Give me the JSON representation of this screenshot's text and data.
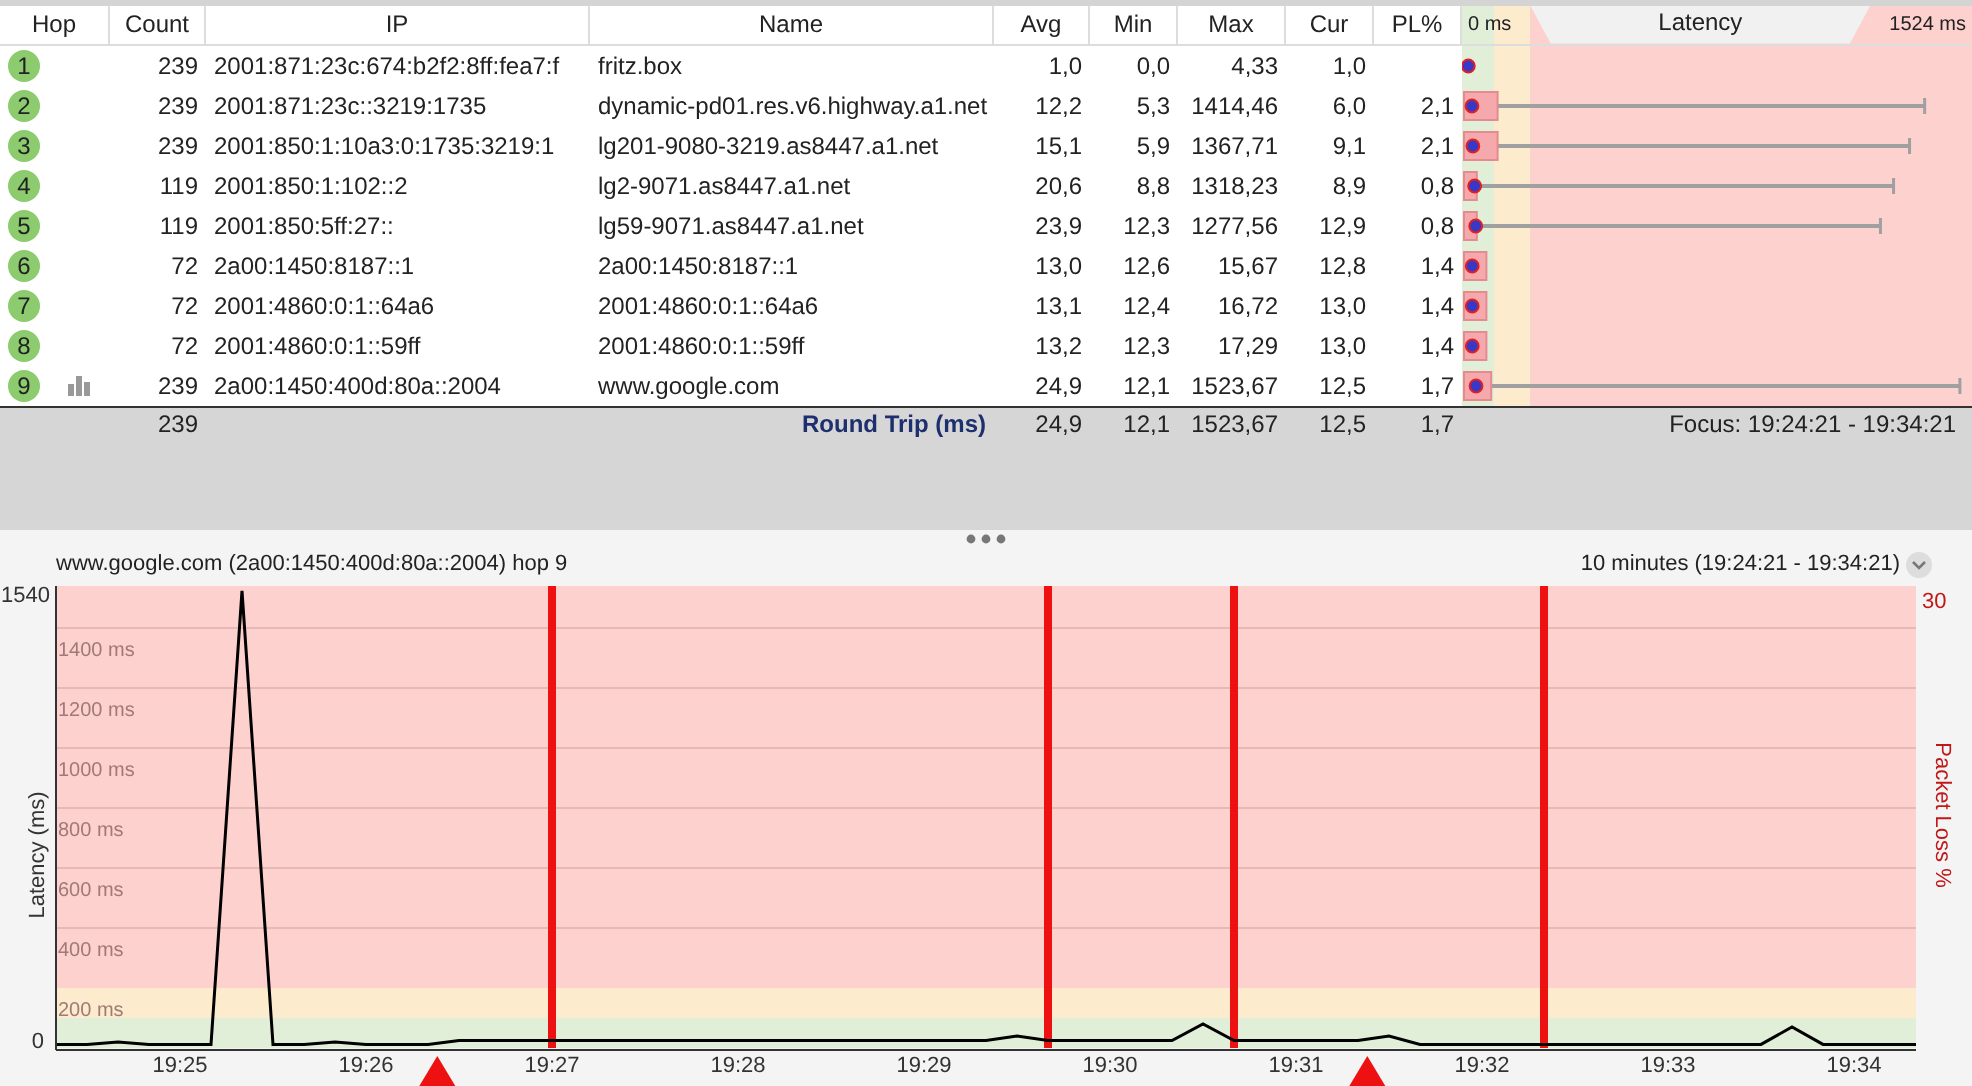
{
  "table": {
    "columns": [
      "Hop",
      "Count",
      "IP",
      "Name",
      "Avg",
      "Min",
      "Max",
      "Cur",
      "PL%",
      "Latency"
    ],
    "scale": {
      "min_label": "0 ms",
      "max_label": "1524 ms"
    },
    "rows": [
      {
        "hop": "1",
        "graphed": false,
        "count": "239",
        "ip": "2001:871:23c:674:b2f2:8ff:fea7:f",
        "name": "fritz.box",
        "avg": "1,0",
        "min": "0,0",
        "max": "4,33",
        "cur": "1,0"
      },
      {
        "hop": "2",
        "graphed": false,
        "count": "239",
        "ip": "2001:871:23c::3219:1735",
        "name": "dynamic-pd01.res.v6.highway.a1.net",
        "avg": "12,2",
        "min": "5,3",
        "max": "1414,46",
        "cur": "6,0",
        "pl": "2,1"
      },
      {
        "hop": "3",
        "graphed": false,
        "count": "239",
        "ip": "2001:850:1:10a3:0:1735:3219:1",
        "name": "lg201-9080-3219.as8447.a1.net",
        "avg": "15,1",
        "min": "5,9",
        "max": "1367,71",
        "cur": "9,1",
        "pl": "2,1"
      },
      {
        "hop": "4",
        "graphed": false,
        "count": "119",
        "ip": "2001:850:1:102::2",
        "name": "lg2-9071.as8447.a1.net",
        "avg": "20,6",
        "min": "8,8",
        "max": "1318,23",
        "cur": "8,9",
        "pl": "0,8"
      },
      {
        "hop": "5",
        "graphed": false,
        "count": "119",
        "ip": "2001:850:5ff:27::",
        "name": "lg59-9071.as8447.a1.net",
        "avg": "23,9",
        "min": "12,3",
        "max": "1277,56",
        "cur": "12,9",
        "pl": "0,8"
      },
      {
        "hop": "6",
        "graphed": false,
        "count": "72",
        "ip": "2a00:1450:8187::1",
        "name": "2a00:1450:8187::1",
        "avg": "13,0",
        "min": "12,6",
        "max": "15,67",
        "cur": "12,8",
        "pl": "1,4"
      },
      {
        "hop": "7",
        "graphed": false,
        "count": "72",
        "ip": "2001:4860:0:1::64a6",
        "name": "2001:4860:0:1::64a6",
        "avg": "13,1",
        "min": "12,4",
        "max": "16,72",
        "cur": "13,0",
        "pl": "1,4"
      },
      {
        "hop": "8",
        "graphed": false,
        "count": "72",
        "ip": "2001:4860:0:1::59ff",
        "name": "2001:4860:0:1::59ff",
        "avg": "13,2",
        "min": "12,3",
        "max": "17,29",
        "cur": "13,0",
        "pl": "1,4"
      },
      {
        "hop": "9",
        "graphed": true,
        "count": "239",
        "ip": "2a00:1450:400d:80a::2004",
        "name": "www.google.com",
        "avg": "24,9",
        "min": "12,1",
        "max": "1523,67",
        "cur": "12,5",
        "pl": "1,7"
      }
    ],
    "summary": {
      "count": "239",
      "label": "Round Trip (ms)",
      "avg": "24,9",
      "min": "12,1",
      "max": "1523,67",
      "cur": "12,5",
      "pl": "1,7",
      "focus": "Focus: 19:24:21 - 19:34:21"
    }
  },
  "graph": {
    "title": "www.google.com (2a00:1450:400d:80a::2004) hop 9",
    "range": "10 minutes (19:24:21 - 19:34:21)",
    "y_min_label": "0",
    "y_max_label": "1540",
    "loss_max_label": "30",
    "loss_axis_title": "Packet Loss %",
    "chart_data": {
      "type": "line",
      "ylim": [
        0,
        1540
      ],
      "categories": [
        null,
        null,
        null,
        null,
        "19:25",
        null,
        null,
        null,
        null,
        null,
        "19:26",
        null,
        null,
        null,
        null,
        null,
        "19:27",
        null,
        null,
        null,
        null,
        null,
        "19:28",
        null,
        null,
        null,
        null,
        null,
        "19:29",
        null,
        null,
        null,
        null,
        null,
        "19:30",
        null,
        null,
        null,
        null,
        null,
        "19:31",
        null,
        null,
        null,
        null,
        null,
        "19:32",
        null,
        null,
        null,
        null,
        null,
        "19:33",
        null,
        null,
        null,
        null,
        null,
        "19:34",
        null,
        null
      ],
      "yticks": [
        {
          "value": 200,
          "label": "200 ms"
        },
        {
          "value": 400,
          "label": "400 ms"
        },
        {
          "value": 600,
          "label": "600 ms"
        },
        {
          "value": 800,
          "label": "800 ms"
        },
        {
          "value": 1000,
          "label": "1000 ms"
        },
        {
          "value": 1200,
          "label": "1200 ms"
        },
        {
          "value": 1400,
          "label": "1400 ms"
        }
      ],
      "series": [
        {
          "name": "Latency (ms)",
          "color": "#000000",
          "values": [
            12,
            12,
            20,
            12,
            12,
            12,
            1524,
            12,
            12,
            20,
            12,
            12,
            12,
            25,
            25,
            25,
            25,
            25,
            25,
            25,
            25,
            25,
            25,
            25,
            25,
            25,
            25,
            25,
            25,
            25,
            25,
            40,
            25,
            25,
            25,
            25,
            25,
            80,
            25,
            25,
            25,
            25,
            25,
            40,
            12,
            12,
            12,
            12,
            12,
            12,
            12,
            12,
            12,
            12,
            12,
            12,
            70,
            12,
            12,
            12,
            12
          ]
        }
      ],
      "grid": true
    }
  }
}
